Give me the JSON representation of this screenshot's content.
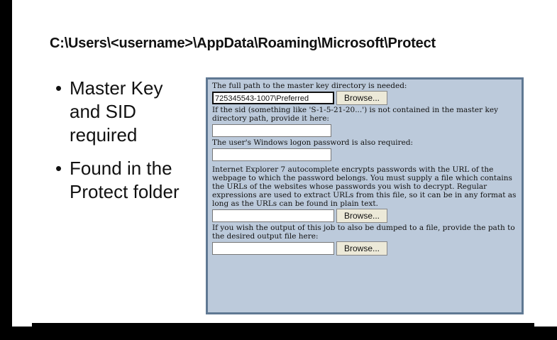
{
  "slide": {
    "path": "C:\\Users\\<username>\\AppData\\Roaming\\Microsoft\\Protect",
    "bullets": [
      {
        "text": "Master Key and SID required"
      },
      {
        "text": "Found in the Protect folder"
      }
    ]
  },
  "form": {
    "label_masterkey": "The full path to the master key directory is needed:",
    "masterkey_value": "725345543-1007\\Preferred",
    "browse_label": "Browse...",
    "label_sid": "If the sid (something like 'S-1-5-21-20...') is not contained in the master key directory path, provide it here:",
    "sid_value": "",
    "label_password": "The user's Windows logon password is also required:",
    "password_value": "",
    "label_ie7": "Internet Explorer 7 autocomplete encrypts passwords with the URL of the webpage to which the password belongs. You must supply a file which contains the URLs of the websites whose passwords you wish to decrypt. Regular expressions are used to extract URLs from this file, so it can be in any format as long as the URLs can be found in plain text.",
    "urlfile_value": "",
    "label_output": "If you wish the output of this job to also be dumped to a file, provide the path to the desired output file here:",
    "output_value": ""
  }
}
